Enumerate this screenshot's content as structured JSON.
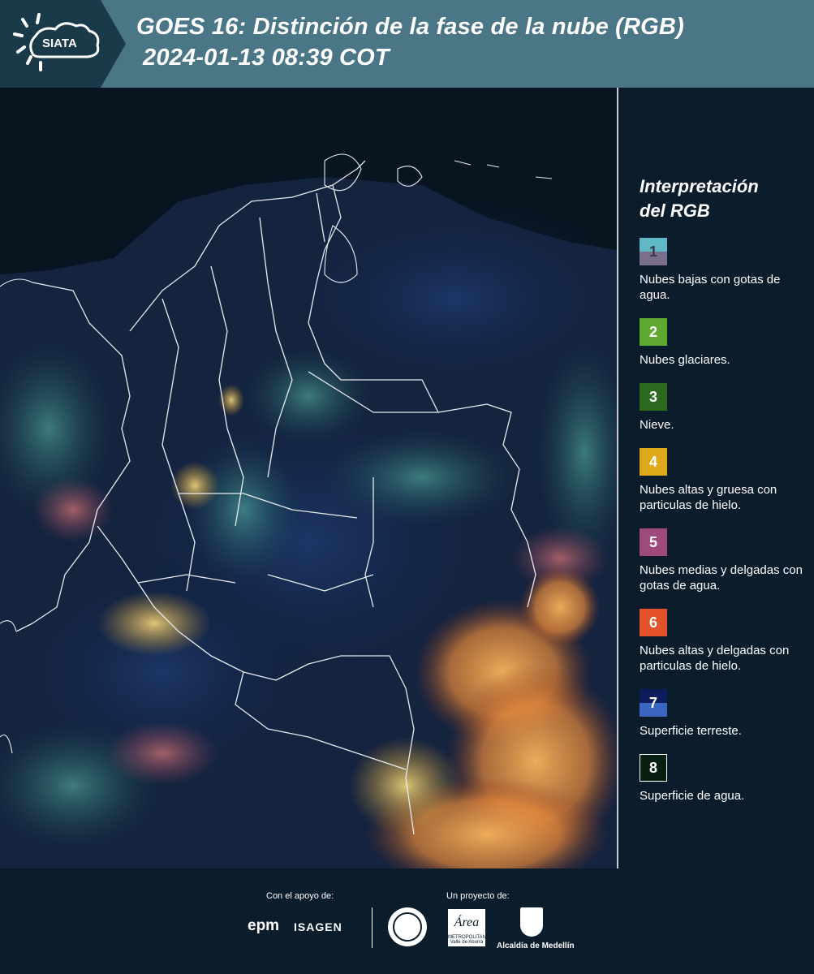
{
  "header": {
    "logo_text": "SIATA",
    "title_line1": "GOES 16: Distinción de la fase de la nube (RGB)",
    "title_line2": "2024-01-13 08:39 COT"
  },
  "legend": {
    "title_line1": "Interpretación",
    "title_line2": "del RGB",
    "items": [
      {
        "number": "1",
        "label": "Nubes bajas con gotas de agua.",
        "colors": [
          "#5fb8c4",
          "#7a6f8c"
        ]
      },
      {
        "number": "2",
        "label": "Nubes glaciares.",
        "colors": [
          "#5fa832"
        ]
      },
      {
        "number": "3",
        "label": "Nieve.",
        "colors": [
          "#2d6a1f"
        ]
      },
      {
        "number": "4",
        "label": "Nubes altas y gruesa con particulas de hielo.",
        "colors": [
          "#e0a91c"
        ]
      },
      {
        "number": "5",
        "label": "Nubes medias y delgadas con gotas de agua.",
        "colors": [
          "#a04a7c"
        ]
      },
      {
        "number": "6",
        "label": "Nubes altas y delgadas con particulas de hielo.",
        "colors": [
          "#e2532c"
        ]
      },
      {
        "number": "7",
        "label": "Superficie terreste.",
        "colors": [
          "#0d1d5c",
          "#3b66c0"
        ]
      },
      {
        "number": "8",
        "label": "Superficie de agua.",
        "colors": [
          "#0a1f14"
        ]
      }
    ]
  },
  "footer": {
    "support_label": "Con el apoyo de:",
    "project_label": "Un proyecto de:",
    "sponsor_1": "epm",
    "sponsor_2": "ISAGEN",
    "partner_2": "Área",
    "partner_2_sub": "METROPOLITANA Valle de Aburrá",
    "partner_3": "Alcaldía de Medellín"
  }
}
